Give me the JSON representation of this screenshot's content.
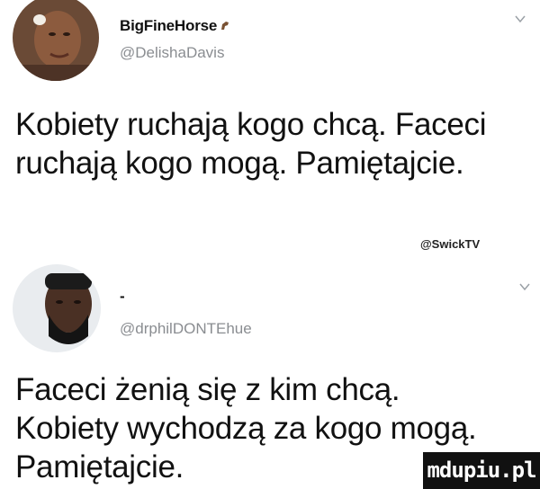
{
  "tweet1": {
    "display_name": "BigFineHorse",
    "handle": "@DelishaDavis",
    "text_line1": "Kobiety ruchają kogo chcą. Faceci",
    "text_line2": "ruchają kogo mogą. Pamiętajcie."
  },
  "credit": "@SwickTV",
  "tweet2": {
    "display_name": "-",
    "handle": "@drphilDONTEhue",
    "text_line1": "Faceci żenią się z kim chcą.",
    "text_line2": "Kobiety wychodzą za kogo mogą.",
    "text_line3": "Pamiętajcie."
  },
  "watermark": "mdupiu.pl",
  "colors": {
    "text": "#111111",
    "handle": "#8a8d91",
    "chevron": "#9aa0a6"
  }
}
